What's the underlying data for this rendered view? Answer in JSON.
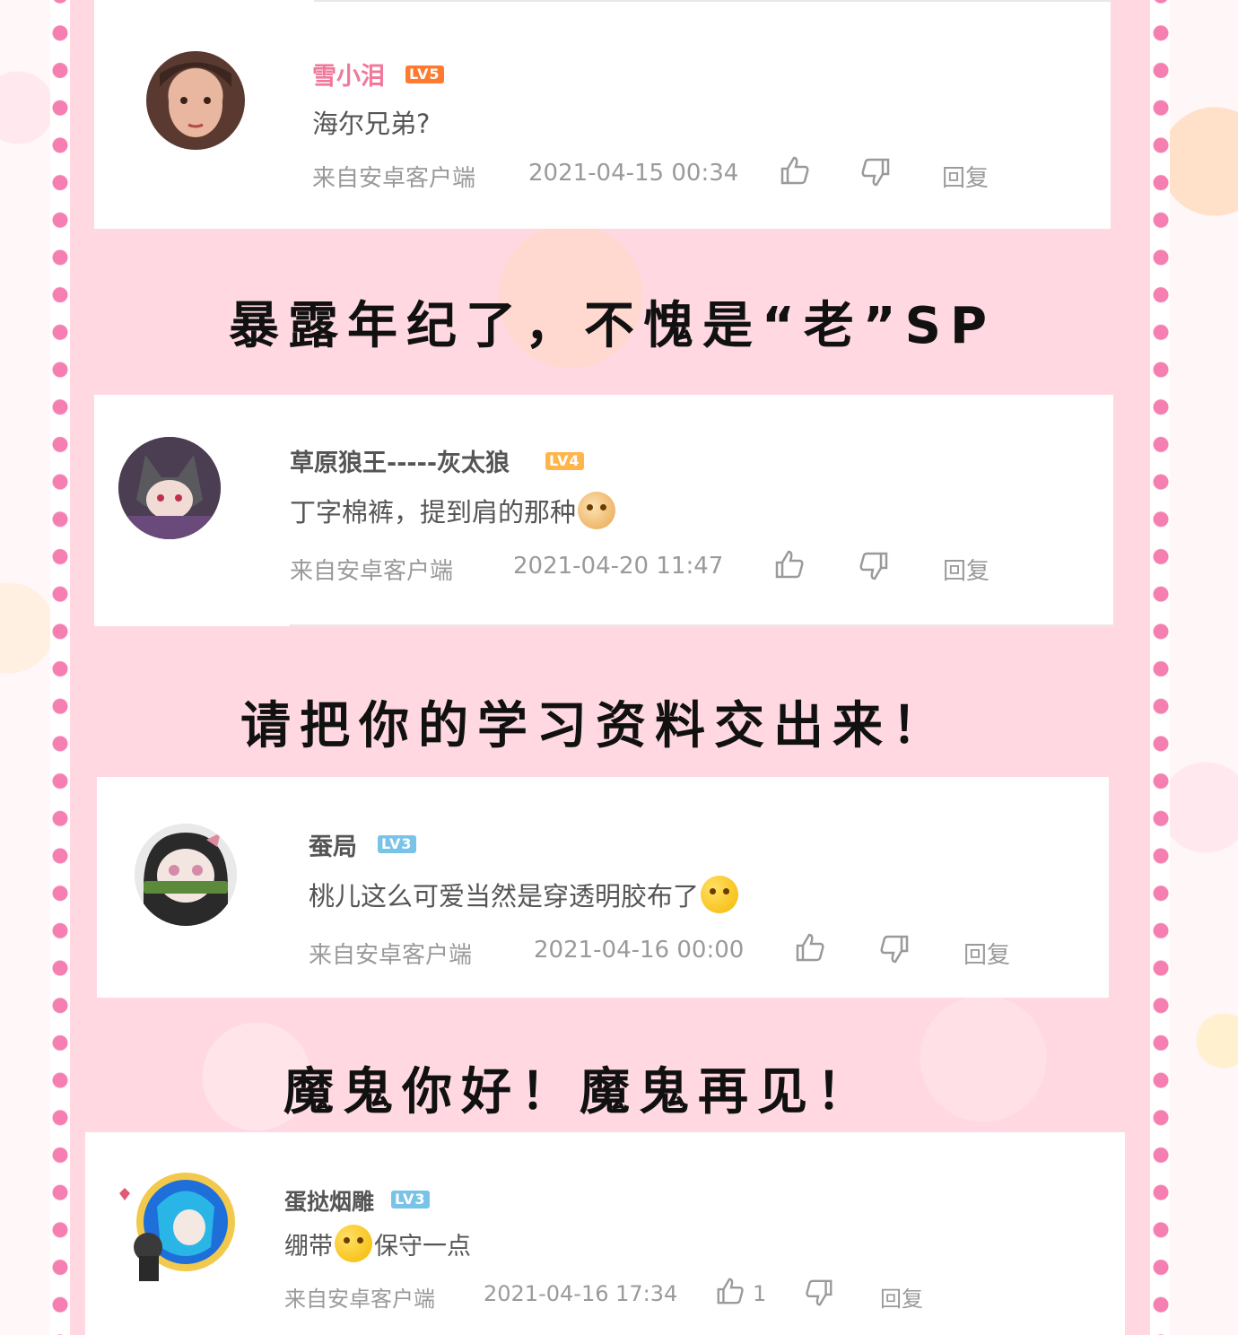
{
  "captions": [
    "暴露年纪了，不愧是“老”SP",
    "请把你的学习资料交出来！",
    "魔鬼你好！魔鬼再见！"
  ],
  "comments": [
    {
      "username": "雪小泪",
      "level": "LV5",
      "level_color": "#ff7a2e",
      "name_color": "#f0789a",
      "text": "海尔兄弟?",
      "source": "来自安卓客户端",
      "time": "2021-04-15 00:34",
      "like_count": "",
      "reply": "回复",
      "avatar_icon": "girl-photo-avatar"
    },
    {
      "username": "草原狼王-----灰太狼",
      "level": "LV4",
      "level_color": "#ffb54a",
      "name_color": "#555555",
      "text": "丁字棉裤，提到肩的那种",
      "emoji": "doge-emoji",
      "source": "来自安卓客户端",
      "time": "2021-04-20 11:47",
      "like_count": "",
      "reply": "回复",
      "avatar_icon": "wolf-anime-avatar"
    },
    {
      "username": "蚕局",
      "level": "LV3",
      "level_color": "#7ac3e8",
      "name_color": "#555555",
      "text": "桃儿这么可爱当然是穿透明胶布了",
      "emoji": "thinking-emoji",
      "source": "来自安卓客户端",
      "time": "2021-04-16 00:00",
      "like_count": "",
      "reply": "回复",
      "avatar_icon": "nezuko-anime-avatar"
    },
    {
      "username": "蛋挞烟雕",
      "level": "LV3",
      "level_color": "#7ac3e8",
      "name_color": "#555555",
      "text_before": "绷带",
      "text_after": "保守一点",
      "emoji": "thinking-emoji",
      "source": "来自安卓客户端",
      "time": "2021-04-16 17:34",
      "like_count": "1",
      "reply": "回复",
      "avatar_icon": "blue-hair-anime-avatar"
    }
  ]
}
